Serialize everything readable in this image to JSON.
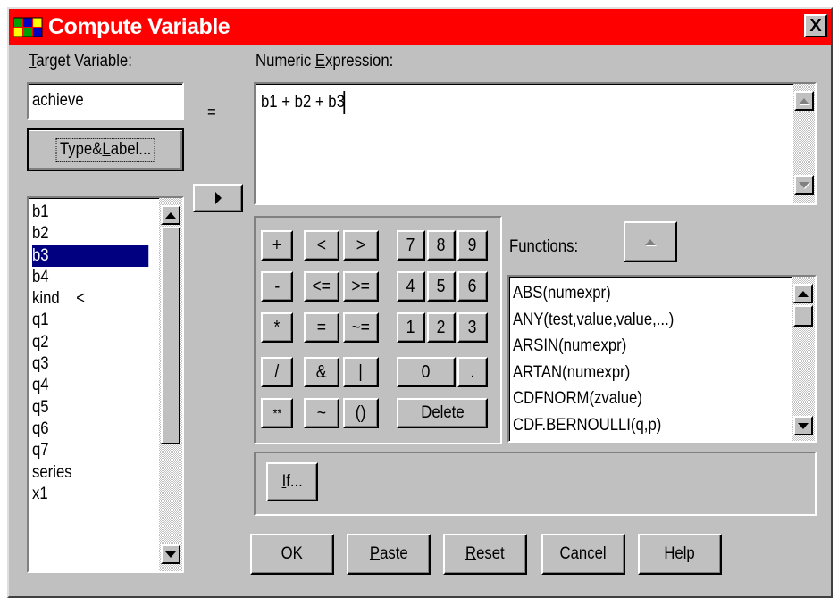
{
  "window": {
    "title": "Compute Variable",
    "close_label": "X"
  },
  "target": {
    "label": "Target Variable:",
    "value": "achieve",
    "equals": "=",
    "type_label_button": "Type&Label..."
  },
  "expression": {
    "label": "Numeric Expression:",
    "value": "b1 + b2 + b3"
  },
  "variables": {
    "items": [
      "b1",
      "b2",
      "b3",
      "b4",
      "kind",
      "q1",
      "q2",
      "q3",
      "q4",
      "q5",
      "q6",
      "q7",
      "series",
      "x1"
    ],
    "selected": "b3",
    "kind_marker": "<"
  },
  "keypad": {
    "plus": "+",
    "lt": "<",
    "gt": ">",
    "seven": "7",
    "eight": "8",
    "nine": "9",
    "minus": "-",
    "le": "<=",
    "ge": ">=",
    "four": "4",
    "five": "5",
    "six": "6",
    "times": "*",
    "eq": "=",
    "ne": "~=",
    "one": "1",
    "two": "2",
    "three": "3",
    "divide": "/",
    "and": "&",
    "or": "|",
    "zero": "0",
    "dot": ".",
    "power": "**",
    "not": "~",
    "parens": "()",
    "delete": "Delete"
  },
  "functions": {
    "label": "Functions:",
    "items": [
      "ABS(numexpr)",
      "ANY(test,value,value,...)",
      "ARSIN(numexpr)",
      "ARTAN(numexpr)",
      "CDFNORM(zvalue)",
      "CDF.BERNOULLI(q,p)"
    ]
  },
  "buttons": {
    "if": "If...",
    "ok": "OK",
    "paste": "Paste",
    "reset": "Reset",
    "cancel": "Cancel",
    "help": "Help"
  },
  "colors": {
    "titlebar": "#ff0000",
    "dialog": "#c0c0c0",
    "selection": "#000080"
  }
}
